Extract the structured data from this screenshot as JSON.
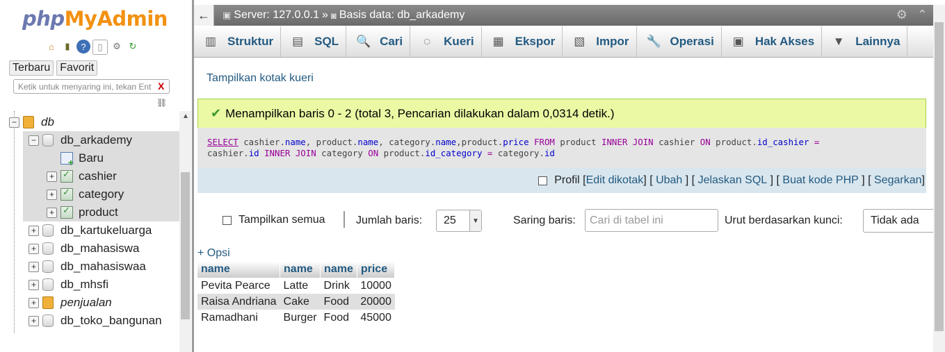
{
  "app": {
    "logo": {
      "php": "php",
      "my": "My",
      "admin": "Admin"
    },
    "nav_tabs": [
      "Terbaru",
      "Favorit"
    ],
    "nav_filter_placeholder": "Ketik untuk menyaring ini, tekan Ent",
    "nav_filter_clear": "X"
  },
  "tree": [
    {
      "label": "db",
      "italic": true,
      "kind": "group",
      "level": 0,
      "expander": "−"
    },
    {
      "label": "db_arkademy",
      "kind": "db",
      "level": 1,
      "expander": "−",
      "highlight": true
    },
    {
      "label": "Baru",
      "kind": "new",
      "level": 2,
      "highlight": true
    },
    {
      "label": "cashier",
      "kind": "table",
      "level": 2,
      "expander": "+",
      "highlight": true
    },
    {
      "label": "category",
      "kind": "table",
      "level": 2,
      "expander": "+",
      "highlight": true
    },
    {
      "label": "product",
      "kind": "table",
      "level": 2,
      "expander": "+",
      "highlight": true
    },
    {
      "label": "db_kartukeluarga",
      "kind": "db",
      "level": 1,
      "expander": "+"
    },
    {
      "label": "db_mahasiswa",
      "kind": "db",
      "level": 1,
      "expander": "+"
    },
    {
      "label": "db_mahasiswaa",
      "kind": "db",
      "level": 1,
      "expander": "+"
    },
    {
      "label": "db_mhsfi",
      "kind": "db",
      "level": 1,
      "expander": "+"
    },
    {
      "label": "penjualan",
      "italic": true,
      "kind": "group",
      "level": 1,
      "expander": "+"
    },
    {
      "label": "db_toko_bangunan",
      "kind": "db",
      "level": 1,
      "expander": "+"
    }
  ],
  "breadcrumb": {
    "collapse": "←",
    "server": "Server: 127.0.0.1",
    "sep": "»",
    "database": "Basis data: db_arkademy"
  },
  "menu": [
    {
      "label": "Struktur",
      "icon": "structure-icon",
      "glyph": "▥"
    },
    {
      "label": "SQL",
      "icon": "sql-icon",
      "glyph": "▤"
    },
    {
      "label": "Cari",
      "icon": "search-icon",
      "glyph": "🔍"
    },
    {
      "label": "Kueri",
      "icon": "query-icon",
      "glyph": "◌"
    },
    {
      "label": "Ekspor",
      "icon": "export-icon",
      "glyph": "▦"
    },
    {
      "label": "Impor",
      "icon": "import-icon",
      "glyph": "▧"
    },
    {
      "label": "Operasi",
      "icon": "wrench-icon",
      "glyph": "🔧"
    },
    {
      "label": "Hak Akses",
      "icon": "privileges-icon",
      "glyph": "▣"
    },
    {
      "label": "Lainnya",
      "icon": "chevron-down-icon",
      "glyph": "▼"
    }
  ],
  "show_query_box": "Tampilkan kotak kueri",
  "success_message": "Menampilkan baris 0 - 2 (total 3, Pencarian dilakukan dalam 0,0314 detik.)",
  "sql": {
    "line1": [
      [
        "kwu",
        "SELECT"
      ],
      [
        "txt",
        " cashier."
      ],
      [
        "col",
        "name"
      ],
      [
        "txt",
        ", product."
      ],
      [
        "col",
        "name"
      ],
      [
        "txt",
        ", category."
      ],
      [
        "col",
        "name"
      ],
      [
        "txt",
        ",product."
      ],
      [
        "col",
        "price"
      ],
      [
        "txt",
        " "
      ],
      [
        "kw",
        "FROM"
      ],
      [
        "txt",
        " product "
      ],
      [
        "kw",
        "INNER JOIN"
      ],
      [
        "txt",
        " cashier "
      ],
      [
        "kw",
        "ON"
      ],
      [
        "txt",
        " product."
      ],
      [
        "col",
        "id_cashier"
      ],
      [
        "txt",
        " "
      ],
      [
        "kw",
        "="
      ]
    ],
    "line2": [
      [
        "txt",
        "cashier."
      ],
      [
        "col",
        "id"
      ],
      [
        "txt",
        " "
      ],
      [
        "kw",
        "INNER JOIN"
      ],
      [
        "txt",
        " category "
      ],
      [
        "kw",
        "ON"
      ],
      [
        "txt",
        " product."
      ],
      [
        "col",
        "id_category"
      ],
      [
        "txt",
        " "
      ],
      [
        "kw",
        "="
      ],
      [
        "txt",
        " category."
      ],
      [
        "col",
        "id"
      ]
    ]
  },
  "sql_links": {
    "profile": "Profil",
    "edit_inline": "Edit dikotak",
    "edit": "Ubah",
    "explain": "Jelaskan SQL",
    "php_code": "Buat kode PHP",
    "refresh": "Segarkan"
  },
  "navigation": {
    "show_all": "Tampilkan semua",
    "rows_label": "Jumlah baris:",
    "rows_value": "25",
    "filter_label": "Saring baris:",
    "filter_placeholder": "Cari di tabel ini",
    "sort_label": "Urut berdasarkan kunci:",
    "sort_value": "Tidak ada"
  },
  "options_link": "+ Opsi",
  "table": {
    "headers": [
      "name",
      "name",
      "name",
      "price"
    ],
    "rows": [
      [
        "Pevita Pearce",
        "Latte",
        "Drink",
        "10000"
      ],
      [
        "Raisa Andriana",
        "Cake",
        "Food",
        "20000"
      ],
      [
        "Ramadhani",
        "Burger",
        "Food",
        "45000"
      ]
    ]
  },
  "colors": {
    "link": "#235a81",
    "success_bg": "#ebf8a4",
    "topbar": "#777777"
  }
}
